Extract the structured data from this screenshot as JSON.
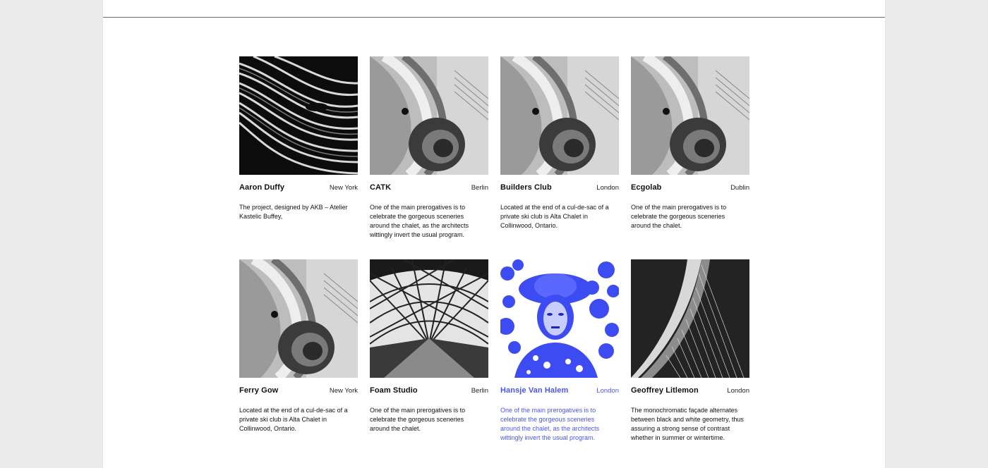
{
  "accent_color": "#4a56ee",
  "projects": [
    {
      "name": "Aaron Duffy",
      "city": "New York",
      "desc": "The project, designed by AKB – Atelier Kastelic Buffey,",
      "image": "curved-slats-architecture"
    },
    {
      "name": "CATK",
      "city": "Berlin",
      "desc": "One of the main prerogatives is to celebrate the gorgeous sceneries around the chalet, as the architects wittingly invert the usual program.",
      "image": "spiral-staircase"
    },
    {
      "name": "Builders Club",
      "city": "London",
      "desc": "Located at the end of a cul-de-sac of a private ski club is Alta Chalet in Collinwood, Ontario.",
      "image": "spiral-staircase"
    },
    {
      "name": "Ecgolab",
      "city": "Dublin",
      "desc": "One of the main prerogatives is to celebrate the gorgeous sceneries around the chalet.",
      "image": "spiral-staircase"
    },
    {
      "name": "Ferry Gow",
      "city": "New York",
      "desc": "Located at the end of a cul-de-sac of a private ski club is Alta Chalet in Collinwood, Ontario.",
      "image": "spiral-staircase"
    },
    {
      "name": "Foam Studio",
      "city": "Berlin",
      "desc": "One of the main prerogatives is to celebrate the gorgeous sceneries around the chalet.",
      "image": "glass-dome-roof"
    },
    {
      "name": "Hansje Van Halem",
      "city": "London",
      "desc": "One of the main prerogatives is to celebrate the gorgeous sceneries around the chalet, as the architects wittingly invert the usual program.",
      "image": "woman-in-hat-blue-duotone",
      "active": true
    },
    {
      "name": "Geoffrey Litlemon",
      "city": "London",
      "desc": "The monochromatic façade alternates between black and white geometry, thus assuring a strong sense of contrast whether in summer or wintertime.",
      "image": "cable-tower"
    }
  ]
}
